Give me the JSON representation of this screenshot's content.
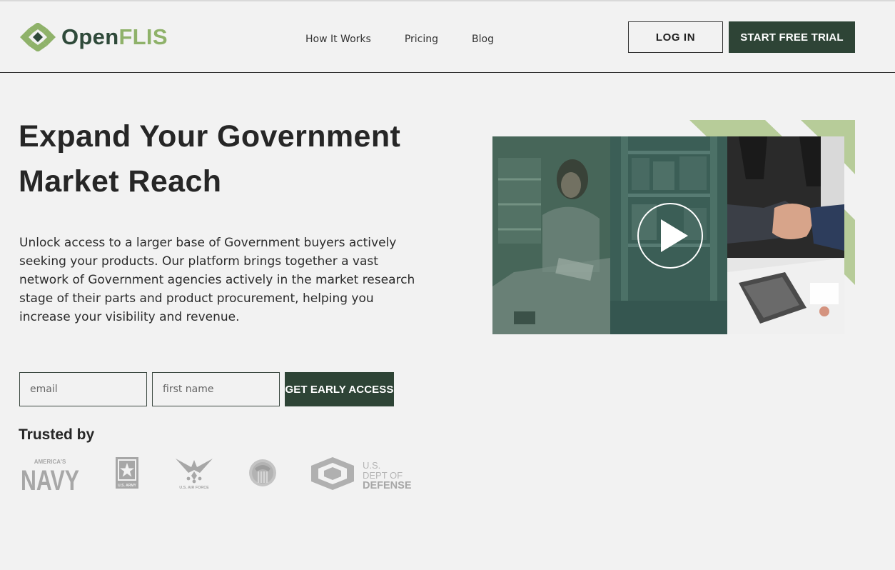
{
  "brand": {
    "name_part1": "Open",
    "name_part2": "FLIS",
    "colors": {
      "dark": "#2f4a3a",
      "light": "#8fb26a",
      "button": "#2e4436"
    }
  },
  "nav": {
    "items": [
      {
        "label": "How It Works"
      },
      {
        "label": "Pricing"
      },
      {
        "label": "Blog"
      }
    ]
  },
  "header": {
    "login_label": "LOG IN",
    "trial_label": "START FREE TRIAL"
  },
  "hero": {
    "title_line1": "Expand Your Government",
    "title_line2": "Market Reach",
    "description": "Unlock access to a larger base of Government buyers actively seeking your products. Our platform brings together a vast network of Government agencies actively in the market research stage of their parts and product procurement, helping you increase your visibility and revenue."
  },
  "form": {
    "email_placeholder": "email",
    "firstname_placeholder": "first name",
    "submit_label": "GET EARLY ACCESS"
  },
  "trusted": {
    "heading": "Trusted by",
    "logos": [
      {
        "icon": "navy-logo",
        "text_top": "AMERICA'S",
        "text_main": "NAVY"
      },
      {
        "icon": "army-logo",
        "text": "U.S. ARMY"
      },
      {
        "icon": "air-force-logo",
        "text": "U.S. AIR FORCE"
      },
      {
        "icon": "dla-seal-logo"
      },
      {
        "icon": "dod-logo",
        "text_line1": "U.S.",
        "text_line2": "DEPT OF",
        "text_line3": "DEFENSE"
      }
    ]
  },
  "video": {
    "icon": "play-icon"
  }
}
